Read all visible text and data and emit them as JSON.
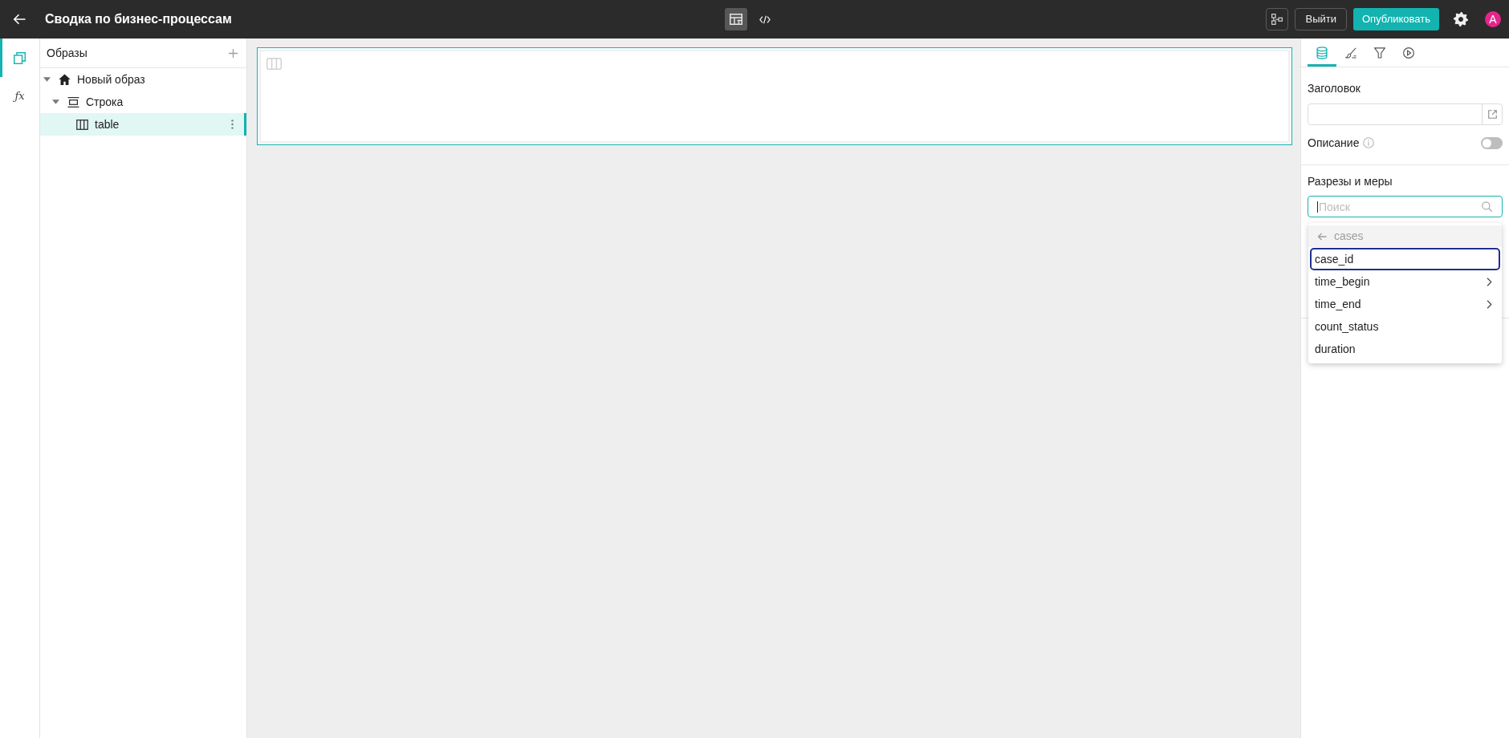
{
  "top_bar": {
    "title": "Сводка по бизнес-процессам",
    "view_modes": [
      {
        "kind": "layout",
        "selected": true
      },
      {
        "kind": "code",
        "selected": false
      }
    ],
    "buttons": [
      {
        "kind": "structure"
      },
      {
        "kind": "outline",
        "label": "Выйти"
      },
      {
        "kind": "primary",
        "label": "Опубликовать"
      }
    ],
    "avatar": "A"
  },
  "rail": [
    {
      "kind": "pages",
      "selected": true
    },
    {
      "kind": "formula",
      "label": "ƒx",
      "selected": false
    }
  ],
  "tree": {
    "title": "Образы",
    "items": [
      {
        "label": "Новый образ",
        "kind": "home",
        "expanded": true,
        "selected": false,
        "children": [
          {
            "label": "Строка",
            "kind": "row",
            "expanded": true,
            "selected": false,
            "children": [
              {
                "label": "table",
                "kind": "table",
                "selected": true
              }
            ]
          }
        ]
      }
    ]
  },
  "canvas": {
    "widgets": [
      {
        "kind": "table",
        "selected": true
      }
    ]
  },
  "properties": {
    "tabs": [
      {
        "kind": "data",
        "selected": true
      },
      {
        "kind": "style",
        "selected": false
      },
      {
        "kind": "filters",
        "selected": false
      },
      {
        "kind": "actions",
        "selected": false
      }
    ],
    "title_field": {
      "label": "Заголовок"
    },
    "description": {
      "label": "Описание",
      "on": false
    },
    "dimensions": {
      "label": "Разрезы и меры",
      "search": {
        "placeholder": "Поиск",
        "focused": true
      },
      "dropdown": {
        "back_label": "cases",
        "items": [
          {
            "label": "case_id",
            "selected": true,
            "submenu": false
          },
          {
            "label": "time_begin",
            "selected": false,
            "submenu": true
          },
          {
            "label": "time_end",
            "selected": false,
            "submenu": true
          },
          {
            "label": "count_status",
            "selected": false,
            "submenu": false
          },
          {
            "label": "duration",
            "selected": false,
            "submenu": false
          }
        ]
      }
    }
  }
}
